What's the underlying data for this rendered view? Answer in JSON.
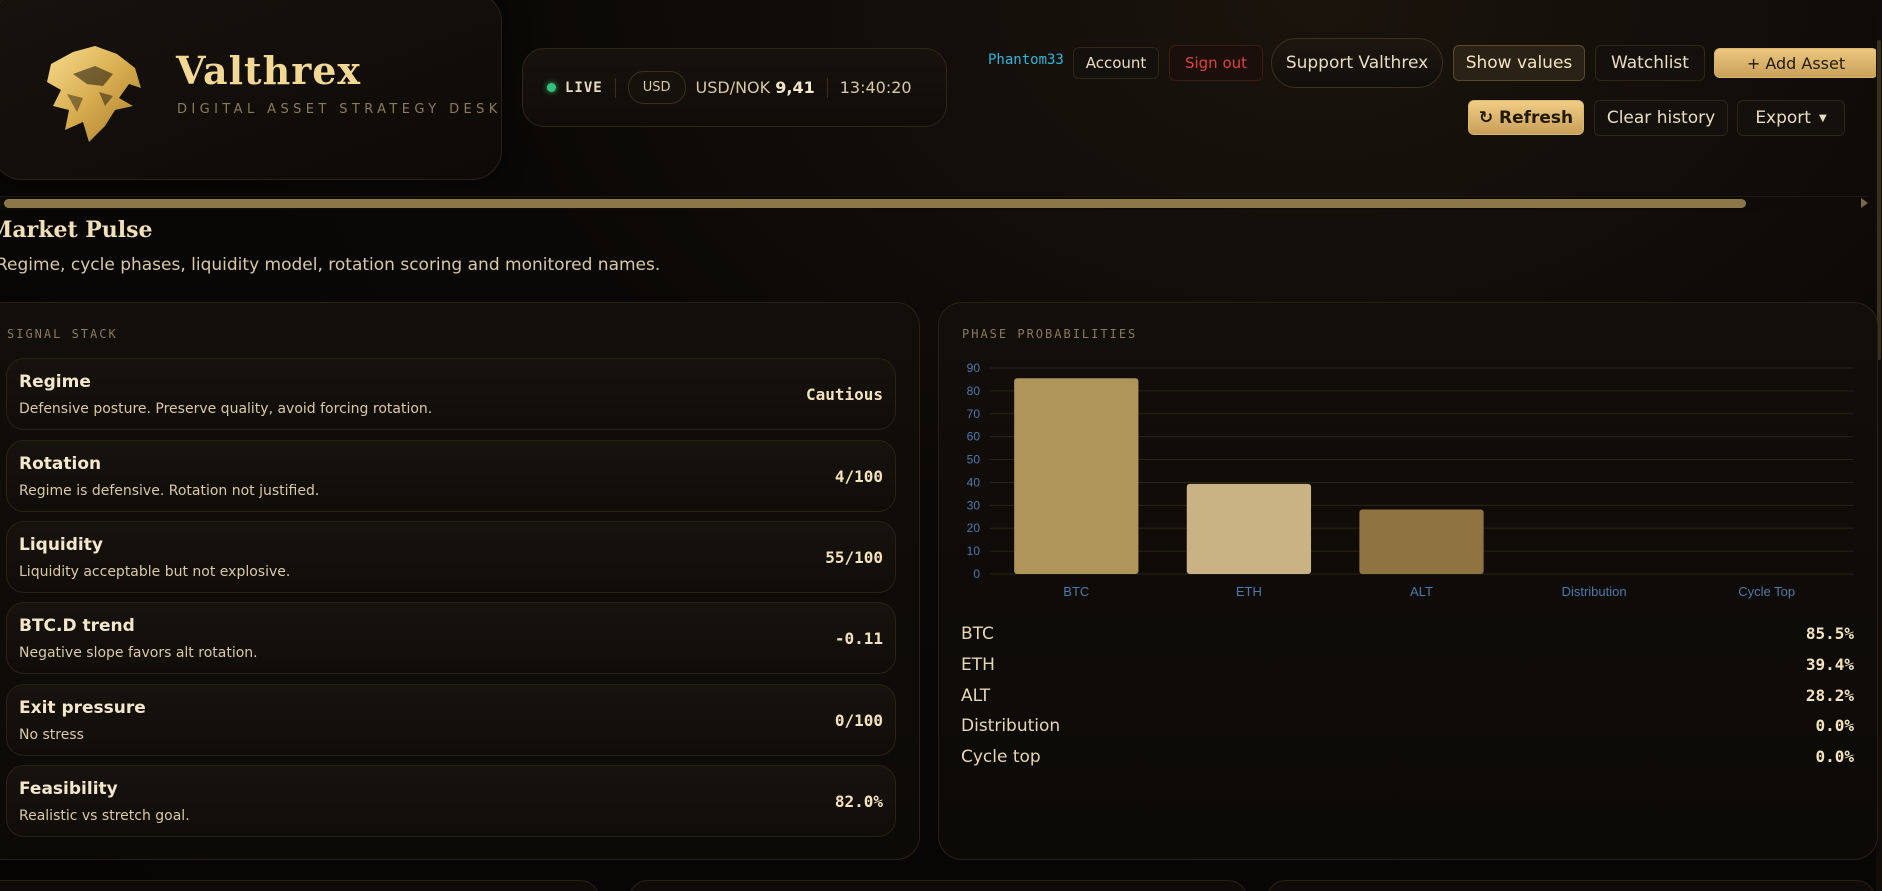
{
  "brand": {
    "name": "Valthrex",
    "tagline": "DIGITAL ASSET STRATEGY DESK"
  },
  "status": {
    "live_label": "LIVE",
    "currency": "USD",
    "pair_label": "USD/NOK",
    "pair_value": "9,41",
    "time": "13:40:20",
    "live_color": "#35c07a"
  },
  "toolbar": {
    "username": "Phantom33",
    "account_label": "Account",
    "signout_label": "Sign out",
    "support_label": "Support Valthrex",
    "show_values_label": "Show values",
    "watchlist_label": "Watchlist",
    "add_asset_label": "+ Add Asset",
    "refresh_label": "↻ Refresh",
    "clear_history_label": "Clear history",
    "export_label": "Export"
  },
  "section": {
    "title": "Market Pulse",
    "subtitle": "Regime, cycle phases, liquidity model, rotation scoring and monitored names."
  },
  "signal_stack": {
    "label": "SIGNAL STACK",
    "items": [
      {
        "name": "Regime",
        "desc": "Defensive posture. Preserve quality, avoid forcing rotation.",
        "value": "Cautious"
      },
      {
        "name": "Rotation",
        "desc": "Regime is defensive. Rotation not justified.",
        "value": "4/100"
      },
      {
        "name": "Liquidity",
        "desc": "Liquidity acceptable but not explosive.",
        "value": "55/100"
      },
      {
        "name": "BTC.D trend",
        "desc": "Negative slope favors alt rotation.",
        "value": "-0.11"
      },
      {
        "name": "Exit pressure",
        "desc": "No stress",
        "value": "0/100"
      },
      {
        "name": "Feasibility",
        "desc": "Realistic vs stretch goal.",
        "value": "82.0%"
      }
    ]
  },
  "phase_probabilities": {
    "label": "PHASE PROBABILITIES",
    "rows": [
      {
        "label": "BTC",
        "value": "85.5%"
      },
      {
        "label": "ETH",
        "value": "39.4%"
      },
      {
        "label": "ALT",
        "value": "28.2%"
      },
      {
        "label": "Distribution",
        "value": "0.0%"
      },
      {
        "label": "Cycle top",
        "value": "0.0%"
      }
    ]
  },
  "chart_data": {
    "type": "bar",
    "categories": [
      "BTC",
      "ETH",
      "ALT",
      "Distribution",
      "Cycle Top"
    ],
    "values": [
      85.5,
      39.4,
      28.2,
      0,
      0
    ],
    "colors": [
      "#b0955a",
      "#c9b283",
      "#8f7341",
      "#8f7341",
      "#8f7341"
    ],
    "title": "",
    "xlabel": "",
    "ylabel": "",
    "ylim": [
      0,
      90
    ],
    "yticks": [
      0,
      10,
      20,
      30,
      40,
      50,
      60,
      70,
      80,
      90
    ],
    "grid": true,
    "tick_color": "#4f7aa8"
  }
}
